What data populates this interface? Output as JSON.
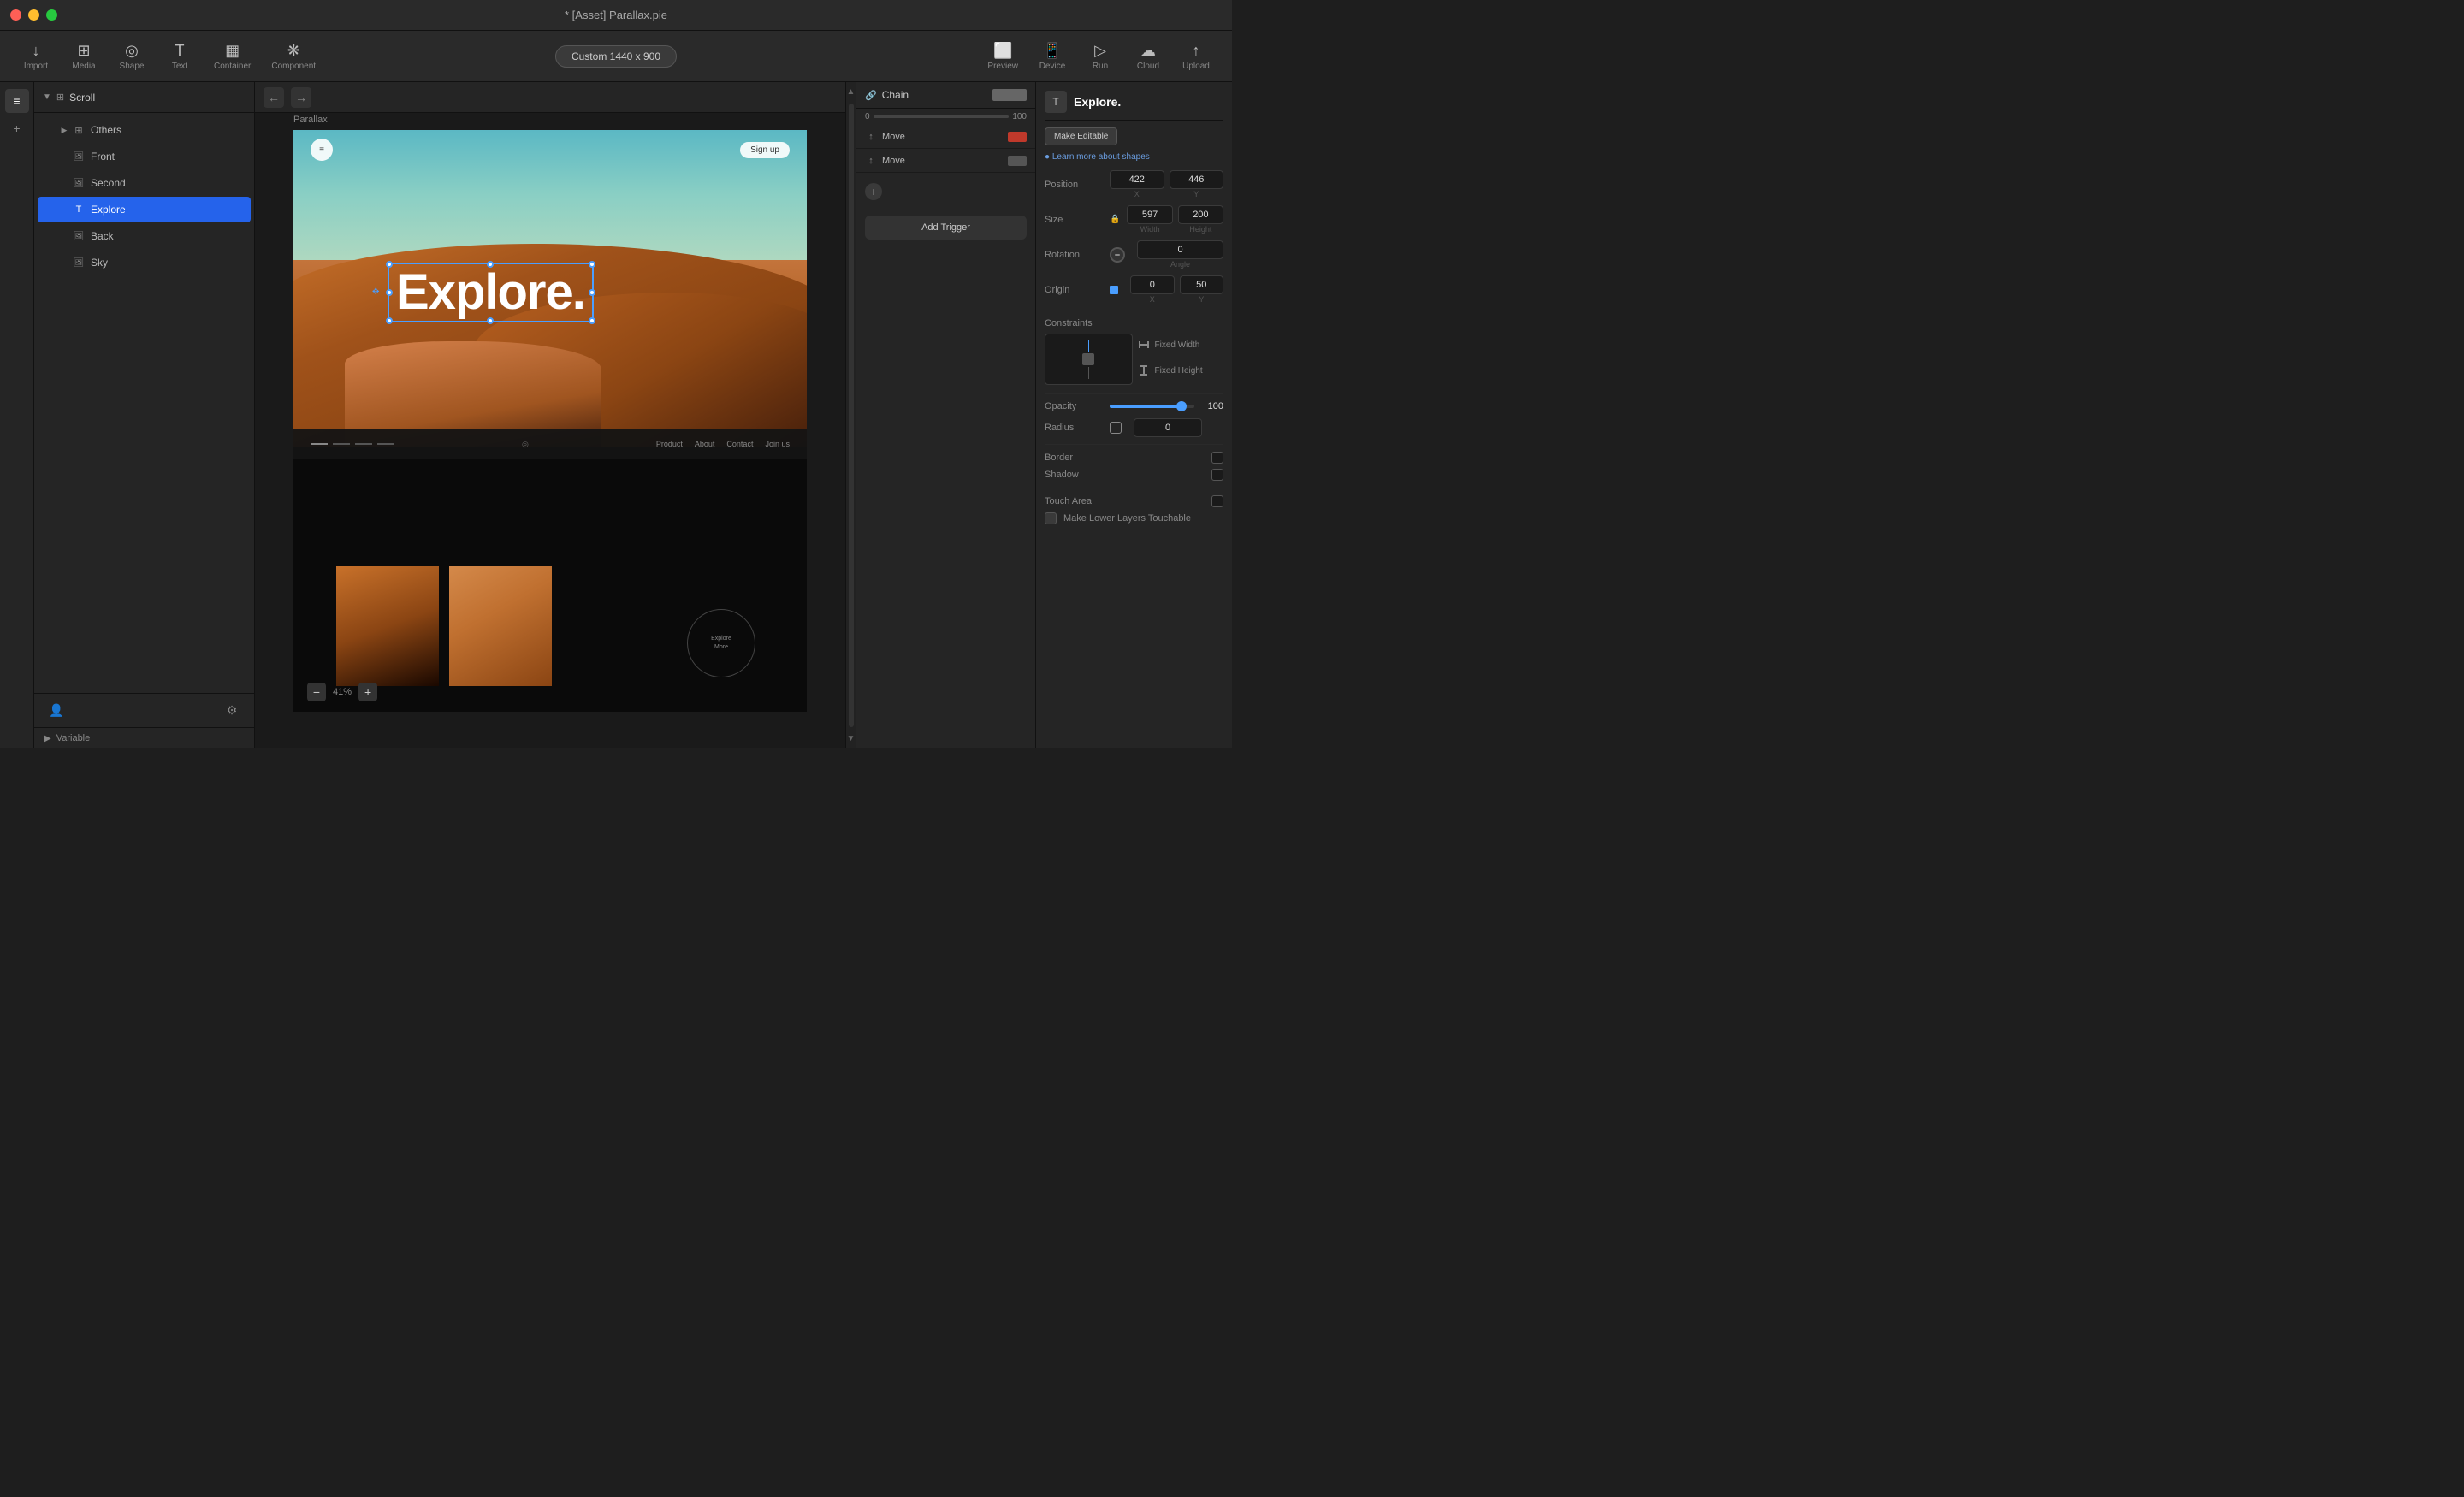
{
  "app": {
    "title": "* [Asset] Parallax.pie"
  },
  "toolbar": {
    "import_label": "Import",
    "media_label": "Media",
    "shape_label": "Shape",
    "text_label": "Text",
    "container_label": "Container",
    "component_label": "Component",
    "preview_label": "Preview",
    "device_label": "Device",
    "run_label": "Run",
    "cloud_label": "Cloud",
    "upload_label": "Upload",
    "resolution": "Custom  1440 x 900"
  },
  "layers": {
    "title": "Scroll",
    "items": [
      {
        "id": "others",
        "label": "Others",
        "indent": 1,
        "hasChildren": true,
        "icon": "grid"
      },
      {
        "id": "front",
        "label": "Front",
        "indent": 2,
        "icon": "image"
      },
      {
        "id": "second",
        "label": "Second",
        "indent": 2,
        "icon": "image"
      },
      {
        "id": "explore",
        "label": "Explore",
        "indent": 2,
        "icon": "text",
        "selected": true
      },
      {
        "id": "back",
        "label": "Back",
        "indent": 2,
        "icon": "image"
      },
      {
        "id": "sky",
        "label": "Sky",
        "indent": 2,
        "icon": "image"
      }
    ]
  },
  "canvas": {
    "parallax_label": "Parallax",
    "zoom_percent": "41%",
    "signup_btn": "Sign up"
  },
  "explore_text": "Explore.",
  "chain": {
    "title": "Chain",
    "move1_label": "Move",
    "move2_label": "Move",
    "add_label": "+",
    "add_trigger_label": "Add Trigger",
    "range_start": "0",
    "range_end": "100"
  },
  "properties": {
    "element_name": "Explore.",
    "make_editable": "Make Editable",
    "learn_more": "● Learn more about shapes",
    "position_label": "Position",
    "position_x": "422",
    "position_y": "446",
    "pos_x_label": "X",
    "pos_y_label": "Y",
    "size_label": "Size",
    "size_w": "597",
    "size_h": "200",
    "size_w_label": "Width",
    "size_h_label": "Height",
    "rotation_label": "Rotation",
    "rotation_val": "0",
    "rotation_sublabel": "Angle",
    "origin_label": "Origin",
    "origin_x": "0",
    "origin_y": "50",
    "origin_x_label": "X",
    "origin_y_label": "Y",
    "constraints_label": "Constraints",
    "fixed_width_label": "Fixed Width",
    "fixed_height_label": "Fixed Height",
    "opacity_label": "Opacity",
    "opacity_value": "100",
    "radius_label": "Radius",
    "radius_value": "0",
    "border_label": "Border",
    "shadow_label": "Shadow",
    "touch_area_label": "Touch Area",
    "make_touchable_label": "Make Lower Layers Touchable"
  },
  "footer": {
    "variable_label": "Variable"
  }
}
